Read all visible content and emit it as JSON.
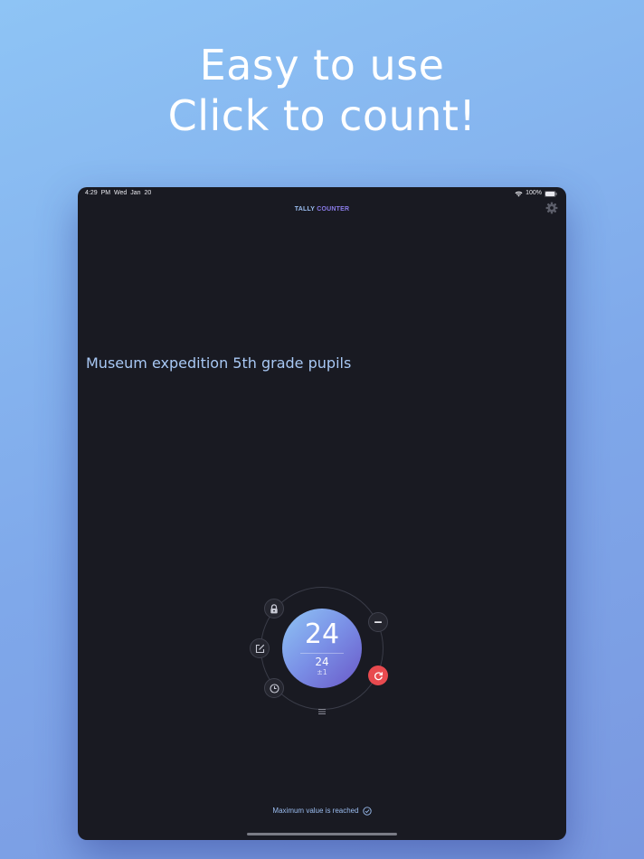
{
  "headline": {
    "line1": "Easy to use",
    "line2": "Click to count!"
  },
  "status_bar": {
    "time": "4:29 PM",
    "date": "Wed Jan 20",
    "battery": "100%"
  },
  "nav": {
    "title_part1": "TALLY ",
    "title_part2": "COUNTER"
  },
  "counter": {
    "title": "Museum expedition 5th grade pupils",
    "value": "24",
    "sub_value": "24",
    "step": "±1"
  },
  "footer": {
    "message": "Maximum value is reached"
  },
  "colors": {
    "background": "#191a22",
    "accent_blue": "#9bbdf0",
    "accent_purple": "#8a7be8",
    "reset_red": "#e84a4f"
  },
  "icons": [
    "wifi-icon",
    "battery-icon",
    "gear-icon",
    "lock-icon",
    "edit-icon",
    "clock-icon",
    "minus-icon",
    "reset-icon",
    "menu-icon",
    "check-circle-icon"
  ]
}
